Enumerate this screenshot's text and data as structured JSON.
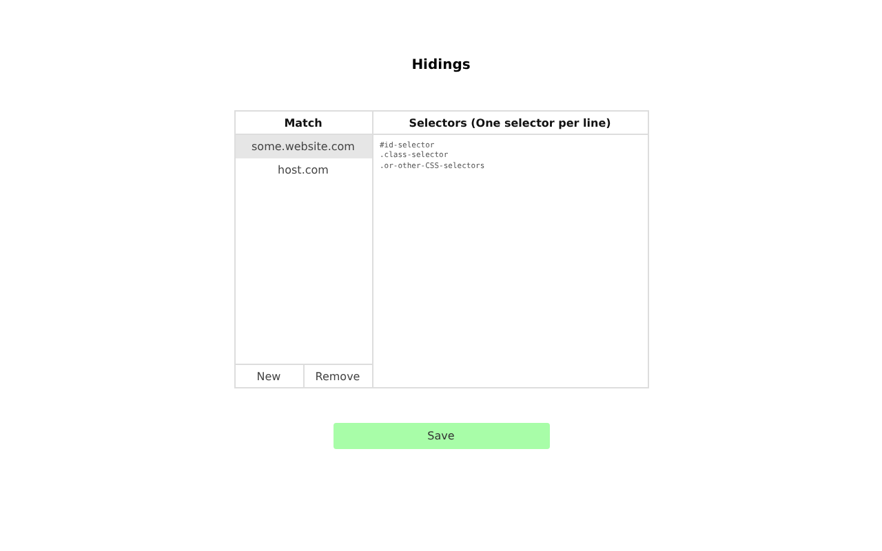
{
  "title": "Hidings",
  "match": {
    "heading": "Match",
    "items": [
      {
        "label": "some.website.com",
        "selected": true
      },
      {
        "label": "host.com",
        "selected": false
      }
    ],
    "buttons": [
      "New",
      "Remove"
    ]
  },
  "selectors": {
    "heading": "Selectors (One selector per line)",
    "value": "#id-selector\n.class-selector\n.or-other-CSS-selectors"
  },
  "save": "Save"
}
